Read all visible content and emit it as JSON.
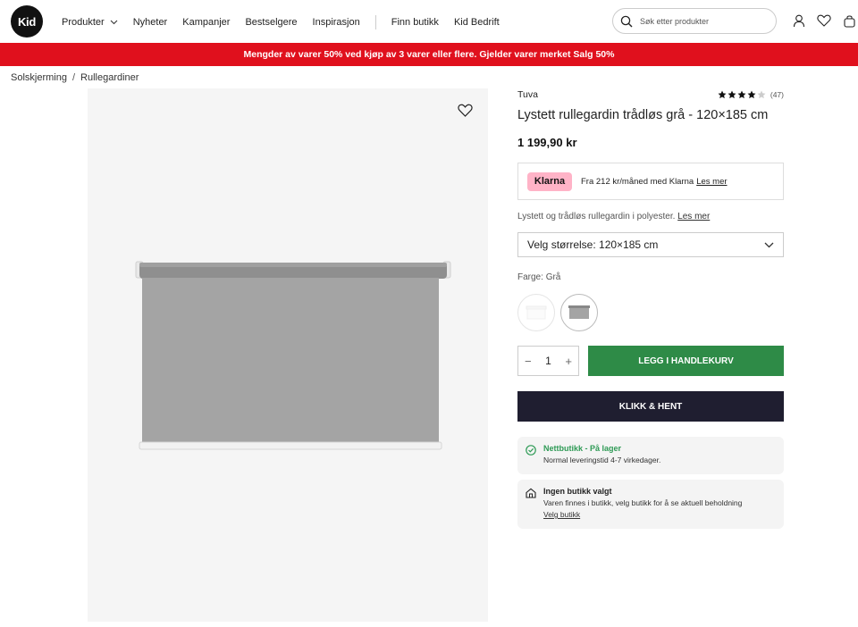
{
  "header": {
    "logo": "Kid",
    "nav": [
      "Produkter",
      "Nyheter",
      "Kampanjer",
      "Bestselgere",
      "Inspirasjon"
    ],
    "nav_secondary": [
      "Finn butikk",
      "Kid Bedrift"
    ],
    "search_placeholder": "Søk etter produkter"
  },
  "banner": "Mengder av varer 50% ved kjøp av 3 varer eller flere. Gjelder varer merket Salg 50%",
  "breadcrumb": [
    "Solskjerming",
    "Rullegardiner"
  ],
  "breadcrumb_sep": "/",
  "product": {
    "brand": "Tuva",
    "rating": 4,
    "rating_max": 5,
    "review_count": "(47)",
    "title": "Lystett rullegardin trådløs grå - 120×185 cm",
    "price": "1 199,90 kr",
    "klarna_logo": "Klarna",
    "klarna_text": "Fra 212 kr/måned med Klarna",
    "klarna_link": "Les mer",
    "description": "Lystett og trådløs rullegardin i polyester.",
    "description_link": "Les mer",
    "size_select": "Velg størrelse: 120×185 cm",
    "color_label": "Farge:",
    "color_value": "Grå",
    "quantity": "1",
    "qty_minus": "−",
    "qty_plus": "+",
    "add_to_cart": "LEGG I HANDLEKURV",
    "click_collect": "KLIKK & HENT"
  },
  "stock": {
    "online_title": "Nettbutikk - På lager",
    "online_sub": "Normal leveringstid 4-7 virkedager.",
    "store_title": "Ingen butikk valgt",
    "store_sub": "Varen finnes i butikk, velg butikk for å se aktuell beholdning",
    "store_link": "Velg butikk"
  },
  "colors": {
    "banner": "#e0101d",
    "add_button": "#2e8b47",
    "click_button": "#1f1e30",
    "klarna": "#ffb3c7",
    "in_stock": "#2e9a55"
  }
}
